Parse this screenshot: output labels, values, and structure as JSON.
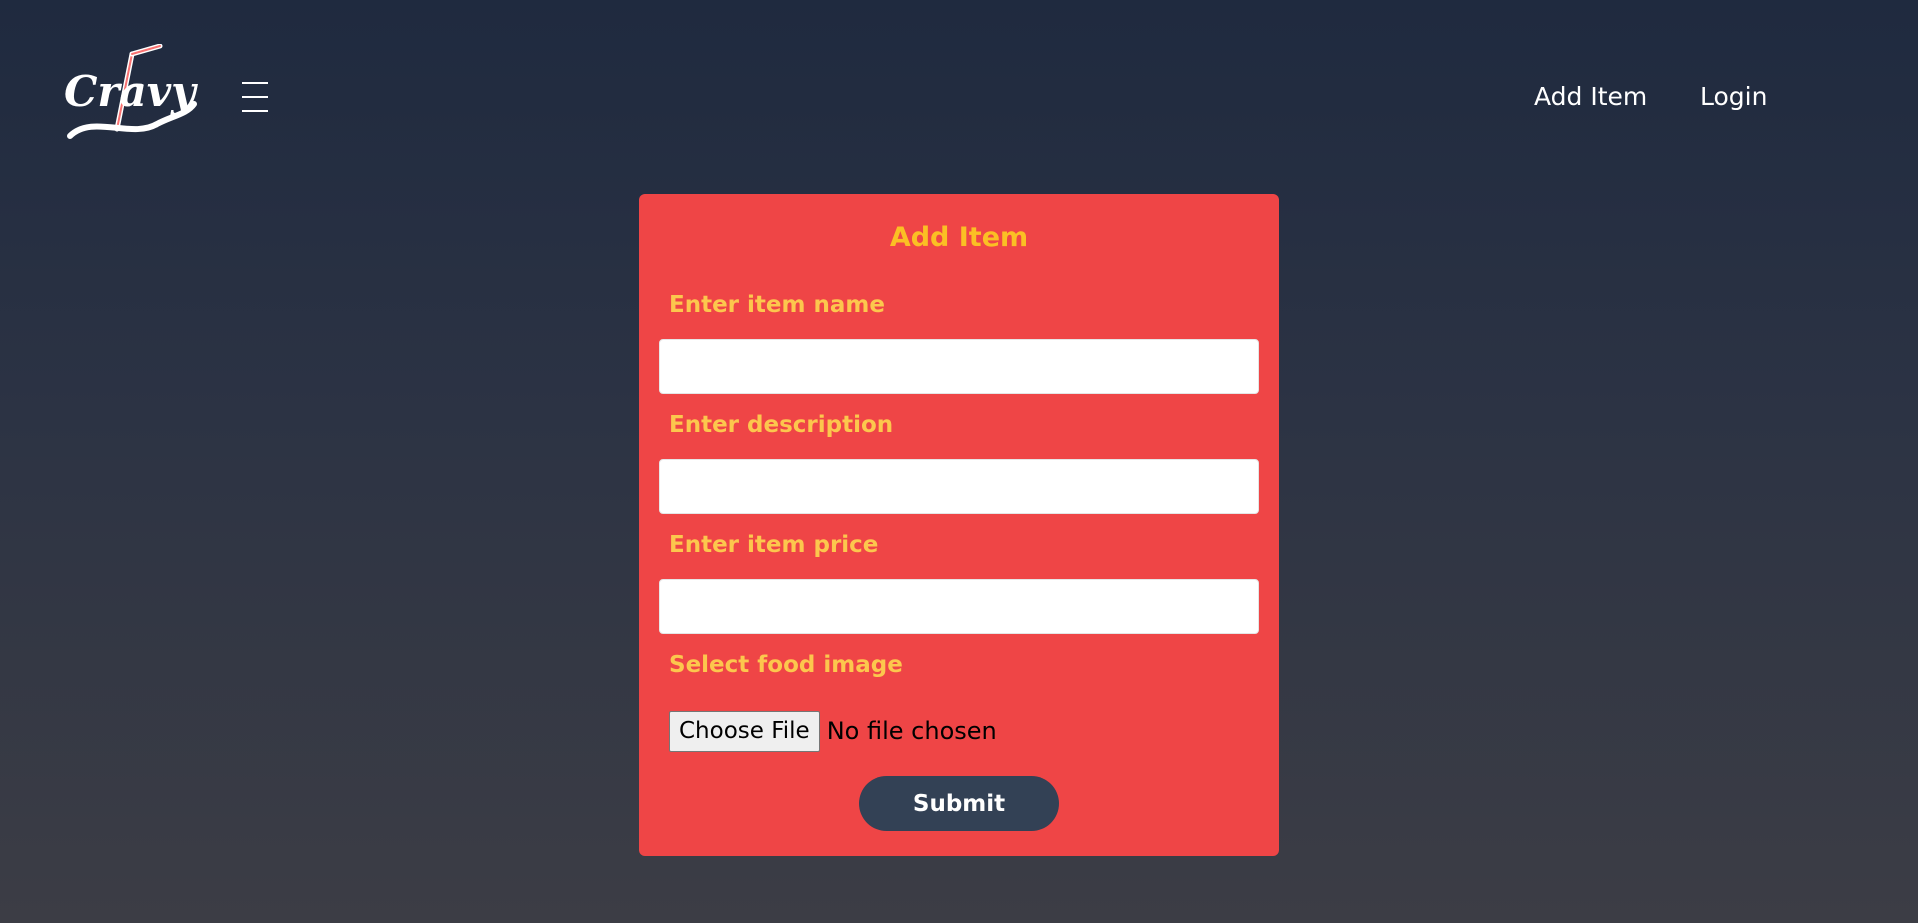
{
  "brand": {
    "logo_text": "Cravy",
    "logo_icon": "straw-icon",
    "colors": {
      "logo": "#ffffff",
      "straw": "#f87171"
    }
  },
  "nav": {
    "menu_icon": "hamburger-icon",
    "links": [
      {
        "label": "Add Item"
      },
      {
        "label": "Login"
      }
    ]
  },
  "form": {
    "title": "Add Item",
    "fields": [
      {
        "label": "Enter item name",
        "value": "",
        "placeholder": ""
      },
      {
        "label": "Enter description",
        "value": "",
        "placeholder": ""
      },
      {
        "label": "Enter item price",
        "value": "",
        "placeholder": ""
      }
    ],
    "image": {
      "label": "Select food image",
      "button_label": "Choose File",
      "status": "No file chosen"
    },
    "submit_label": "Submit"
  },
  "colors": {
    "background_top": "#1f2a3f",
    "background_bottom": "#3c3d45",
    "card": "#ef4546",
    "label": "#fcc74d",
    "title": "#fbbf24",
    "submit": "#334155"
  }
}
